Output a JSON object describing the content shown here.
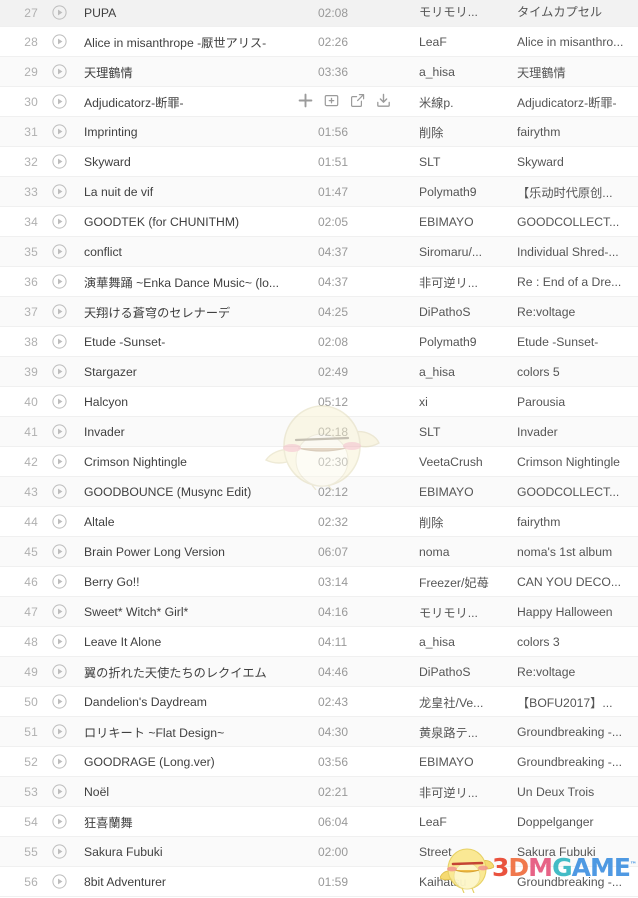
{
  "icons": {
    "play": "play-circle-icon",
    "add": "plus-icon",
    "add_to_playlist": "add-to-playlist-icon",
    "share": "share-icon",
    "download": "download-icon"
  },
  "colors": {
    "row_bg": "#ffffff",
    "row_bg_alt": "#fafafa",
    "row_border": "#f0f0f0",
    "index_text": "#b0b0b0",
    "title_text": "#404040",
    "time_text": "#999999",
    "meta_text": "#555555",
    "watermark_red": "#e8402a",
    "watermark_orange": "#ef6a3a",
    "watermark_pink": "#e5537a",
    "watermark_teal": "#2fb5c0",
    "watermark_blue": "#3c8fe0"
  },
  "watermark": {
    "logo_parts": [
      "3",
      "D",
      "M",
      "G",
      "AME"
    ],
    "trademark": "™",
    "chick_large": "chick-mascot-watermark",
    "chick_small": "chick-mascot-watermark"
  },
  "tracks": [
    {
      "index": "27",
      "title": "PUPA",
      "time": "02:08",
      "artist": "モリモリ...",
      "album": "タイムカプセル",
      "actions": false
    },
    {
      "index": "28",
      "title": "Alice in misanthrope -厭世アリス-",
      "time": "02:26",
      "artist": "LeaF",
      "album": "Alice in misanthro...",
      "actions": false
    },
    {
      "index": "29",
      "title": "天理鶴情",
      "time": "03:36",
      "artist": "a_hisa",
      "album": "天理鶴情",
      "actions": false
    },
    {
      "index": "30",
      "title": "Adjudicatorz-断罪-",
      "time": "",
      "artist": "米線p.",
      "album": "Adjudicatorz-断罪-",
      "actions": true
    },
    {
      "index": "31",
      "title": "Imprinting",
      "time": "01:56",
      "artist": "削除",
      "album": "fairythm",
      "actions": false
    },
    {
      "index": "32",
      "title": "Skyward",
      "time": "01:51",
      "artist": "SLT",
      "album": "Skyward",
      "actions": false
    },
    {
      "index": "33",
      "title": "La nuit de vif",
      "time": "01:47",
      "artist": "Polymath9",
      "album": "【乐动时代原创...",
      "actions": false
    },
    {
      "index": "34",
      "title": "GOODTEK (for CHUNITHM)",
      "time": "02:05",
      "artist": "EBIMAYO",
      "album": "GOODCOLLECT...",
      "actions": false
    },
    {
      "index": "35",
      "title": "conflict",
      "time": "04:37",
      "artist": "Siromaru/...",
      "album": "Individual Shred-...",
      "actions": false
    },
    {
      "index": "36",
      "title": "演華舞踊 ~Enka Dance Music~ (lo...",
      "time": "04:37",
      "artist": "非可逆リ...",
      "album": "Re : End of a Dre...",
      "actions": false
    },
    {
      "index": "37",
      "title": "天翔ける蒼穹のセレナーデ",
      "time": "04:25",
      "artist": "DiPathoS",
      "album": "Re:voltage",
      "actions": false
    },
    {
      "index": "38",
      "title": "Etude -Sunset-",
      "time": "02:08",
      "artist": "Polymath9",
      "album": "Etude -Sunset-",
      "actions": false
    },
    {
      "index": "39",
      "title": "Stargazer",
      "time": "02:49",
      "artist": "a_hisa",
      "album": "colors 5",
      "actions": false
    },
    {
      "index": "40",
      "title": "Halcyon",
      "time": "05:12",
      "artist": "xi",
      "album": "Parousia",
      "actions": false
    },
    {
      "index": "41",
      "title": "Invader",
      "time": "02:18",
      "artist": "SLT",
      "album": "Invader",
      "actions": false
    },
    {
      "index": "42",
      "title": "Crimson Nightingle",
      "time": "02:30",
      "artist": "VeetaCrush",
      "album": "Crimson Nightingle",
      "actions": false
    },
    {
      "index": "43",
      "title": "GOODBOUNCE (Musync Edit)",
      "time": "02:12",
      "artist": "EBIMAYO",
      "album": "GOODCOLLECT...",
      "actions": false
    },
    {
      "index": "44",
      "title": "Altale",
      "time": "02:32",
      "artist": "削除",
      "album": "fairythm",
      "actions": false
    },
    {
      "index": "45",
      "title": "Brain Power Long Version",
      "time": "06:07",
      "artist": "noma",
      "album": "noma's 1st album",
      "actions": false
    },
    {
      "index": "46",
      "title": "Berry Go!!",
      "time": "03:14",
      "artist": "Freezer/妃苺",
      "album": "CAN YOU DECO...",
      "actions": false
    },
    {
      "index": "47",
      "title": "Sweet* Witch* Girl*",
      "time": "04:16",
      "artist": "モリモリ...",
      "album": "Happy Halloween",
      "actions": false
    },
    {
      "index": "48",
      "title": "Leave It Alone",
      "time": "04:11",
      "artist": "a_hisa",
      "album": "colors 3",
      "actions": false
    },
    {
      "index": "49",
      "title": "翼の折れた天使たちのレクイエム",
      "time": "04:46",
      "artist": "DiPathoS",
      "album": "Re:voltage",
      "actions": false
    },
    {
      "index": "50",
      "title": "Dandelion's Daydream",
      "time": "02:43",
      "artist": "龙皇社/Ve...",
      "album": "【BOFU2017】...",
      "actions": false
    },
    {
      "index": "51",
      "title": "ロリキート ~Flat Design~",
      "time": "04:30",
      "artist": "黄泉路テ...",
      "album": "Groundbreaking -...",
      "actions": false
    },
    {
      "index": "52",
      "title": "GOODRAGE (Long.ver)",
      "time": "03:56",
      "artist": "EBIMAYO",
      "album": "Groundbreaking -...",
      "actions": false
    },
    {
      "index": "53",
      "title": "Noël",
      "time": "02:21",
      "artist": "非可逆リ...",
      "album": "Un Deux Trois",
      "actions": false
    },
    {
      "index": "54",
      "title": "狂喜蘭舞",
      "time": "06:04",
      "artist": "LeaF",
      "album": "Doppelganger",
      "actions": false
    },
    {
      "index": "55",
      "title": "Sakura Fubuki",
      "time": "02:00",
      "artist": "Street",
      "album": "Sakura Fubuki",
      "actions": false
    },
    {
      "index": "56",
      "title": "8bit Adventurer",
      "time": "01:59",
      "artist": "Kaihatsu",
      "album": "Groundbreaking -...",
      "actions": false
    }
  ]
}
